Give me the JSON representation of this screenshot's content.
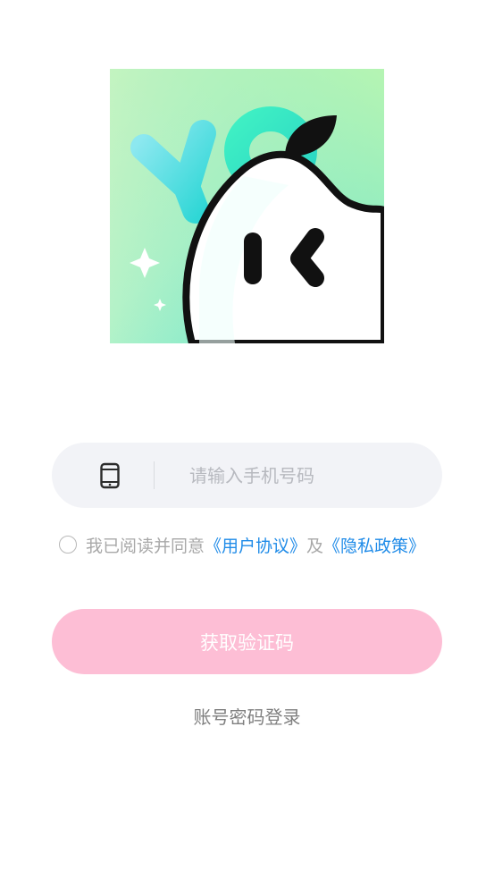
{
  "logo": {
    "icon": "pear-mascot-logo",
    "letters": "YO"
  },
  "phone": {
    "icon": "mobile-phone-icon",
    "placeholder": "请输入手机号码",
    "value": ""
  },
  "agreement": {
    "checked": false,
    "prefix": "我已阅读并同意",
    "user_agreement": "《用户协议》",
    "conjunction": "及",
    "privacy_policy": "《隐私政策》"
  },
  "get_code_button": "获取验证码",
  "password_login_link": "账号密码登录",
  "colors": {
    "button_bg": "#fdbed5",
    "link": "#1f8be8",
    "field_bg": "#f2f3f7"
  }
}
